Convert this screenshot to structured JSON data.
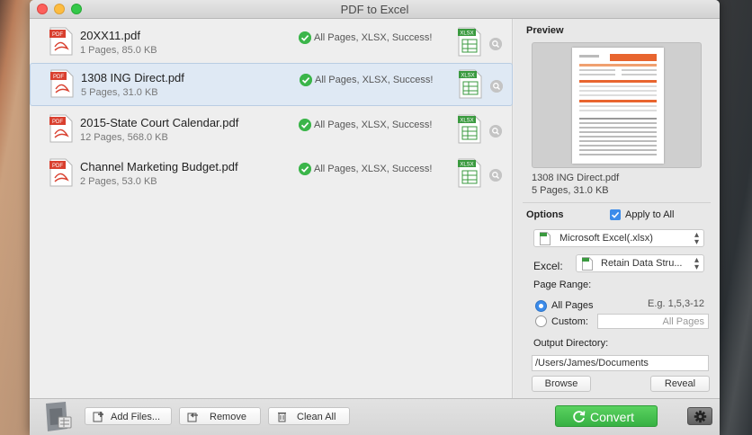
{
  "window": {
    "title": "PDF to Excel"
  },
  "files": [
    {
      "name": "20XX11.pdf",
      "meta": "1 Pages, 85.0 KB",
      "status": "All Pages, XLSX, Success!",
      "selected": false
    },
    {
      "name": "1308 ING Direct.pdf",
      "meta": "5 Pages, 31.0 KB",
      "status": "All Pages, XLSX, Success!",
      "selected": true
    },
    {
      "name": "2015-State Court Calendar.pdf",
      "meta": "12 Pages, 568.0 KB",
      "status": "All Pages, XLSX, Success!",
      "selected": false
    },
    {
      "name": "Channel Marketing Budget.pdf",
      "meta": "2 Pages, 53.0 KB",
      "status": "All Pages, XLSX, Success!",
      "selected": false
    }
  ],
  "icons": {
    "pdf_badge": "PDF",
    "xlsx_badge": "XLSX"
  },
  "preview": {
    "title": "Preview",
    "name": "1308 ING Direct.pdf",
    "meta": "5 Pages, 31.0 KB"
  },
  "options": {
    "title": "Options",
    "apply_all_label": "Apply to All",
    "apply_all_checked": true,
    "format_value": "Microsoft Excel(.xlsx)",
    "excel_label": "Excel:",
    "excel_value": "Retain Data Stru...",
    "page_range_label": "Page Range:",
    "all_pages_label": "All Pages",
    "all_pages_checked": true,
    "page_range_hint": "E.g. 1,5,3-12",
    "custom_label": "Custom:",
    "custom_placeholder": "All Pages",
    "output_dir_label": "Output Directory:",
    "output_dir_value": "/Users/James/Documents",
    "browse_label": "Browse",
    "reveal_label": "Reveal"
  },
  "toolbar": {
    "add_label": "Add Files...",
    "remove_label": "Remove",
    "clean_label": "Clean All",
    "convert_label": "Convert"
  },
  "colors": {
    "success": "#3bb54a",
    "accent_blue": "#3b8bea",
    "convert_green": "#37b143",
    "pdf_red": "#d9402f"
  }
}
